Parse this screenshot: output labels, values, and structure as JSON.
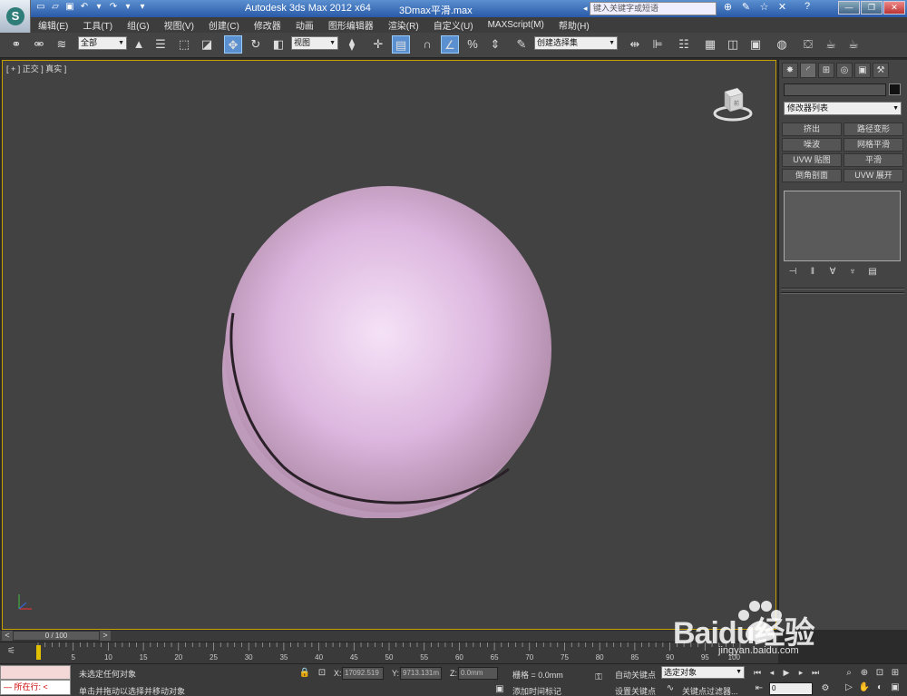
{
  "title": {
    "app": "Autodesk 3ds Max  2012 x64",
    "file": "3Dmax平滑.max",
    "search_placeholder": "键入关键字或短语",
    "help": "?"
  },
  "menu": [
    "编辑(E)",
    "工具(T)",
    "组(G)",
    "视图(V)",
    "创建(C)",
    "修改器",
    "动画",
    "图形编辑器",
    "渲染(R)",
    "自定义(U)",
    "MAXScript(M)",
    "帮助(H)"
  ],
  "toolbar": {
    "selection_filter": "全部",
    "ref_coord": "视图",
    "named_selection": "创建选择集"
  },
  "viewport": {
    "label": "[ + ] 正交 ] 真实 ]",
    "viewcube_label": "前"
  },
  "command_panel": {
    "modifier_list": "修改器列表",
    "buttons": [
      "挤出",
      "路径变形",
      "噪波",
      "网格平滑",
      "UVW 贴图",
      "平滑",
      "倒角剖面",
      "UVW 展开"
    ]
  },
  "timeline": {
    "slider_label": "0 / 100",
    "ticks": [
      "0",
      "5",
      "10",
      "15",
      "20",
      "25",
      "30",
      "35",
      "40",
      "45",
      "50",
      "55",
      "60",
      "65",
      "70",
      "75",
      "80",
      "85",
      "90",
      "95",
      "100"
    ]
  },
  "status": {
    "mini_listener": "所在行:",
    "selection_status": "未选定任何对象",
    "prompt": "单击并拖动以选择并移动对象",
    "x_label": "X:",
    "x_value": "17092.519",
    "y_label": "Y:",
    "y_value": "9713.131m",
    "z_label": "Z:",
    "z_value": "0.0mm",
    "grid": "栅格 = 0.0mm",
    "add_time_tag": "添加时间标记",
    "auto_key": "自动关键点",
    "set_key": "设置关键点",
    "selected_dropdown": "选定对象",
    "key_filters": "关键点过滤器...",
    "frame_value": "0"
  },
  "watermark": {
    "brand": "Baidu经验",
    "url": "jingyan.baidu.com"
  },
  "colors": {
    "sphere": "#e6c4e8",
    "viewport_bg": "#424242",
    "active_border": "#c8a000"
  }
}
